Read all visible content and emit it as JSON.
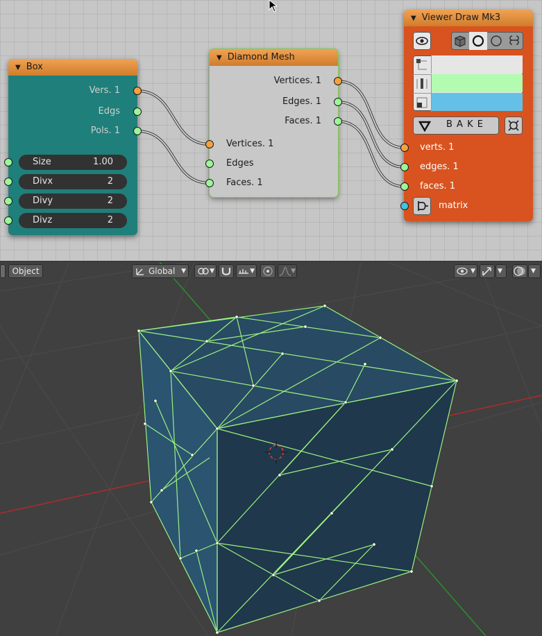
{
  "node_editor": {
    "box_node": {
      "title": "Box",
      "outputs": [
        "Vers. 1",
        "Edgs",
        "Pols. 1"
      ],
      "fields": [
        {
          "name": "Size",
          "value": "1.00"
        },
        {
          "name": "Divx",
          "value": "2"
        },
        {
          "name": "Divy",
          "value": "2"
        },
        {
          "name": "Divz",
          "value": "2"
        }
      ],
      "body_color": "#1f7f7a"
    },
    "diamond_node": {
      "title": "Diamond Mesh",
      "outputs": [
        "Vertices. 1",
        "Edges. 1",
        "Faces. 1"
      ],
      "inputs": [
        "Vertices. 1",
        "Edges",
        "Faces. 1"
      ],
      "body_color": "#c8c8c8",
      "border_color": "#7ecb4a"
    },
    "viewer_node": {
      "title": "Viewer Draw Mk3",
      "bake_label": "B A K E",
      "inputs": [
        "verts. 1",
        "edges. 1",
        "faces. 1",
        "matrix"
      ],
      "swatches": [
        "#e6e6e6",
        "#b3fbb0",
        "#64c0e6"
      ],
      "body_color": "#d8531f"
    }
  },
  "viewport": {
    "mode_label": "Object",
    "orientation_label": "Global",
    "mesh_face_color": "#24445d",
    "wire_color": "#9cf27e",
    "x_axis_color": "#b12a2a",
    "y_axis_color": "#2d8f2d"
  }
}
